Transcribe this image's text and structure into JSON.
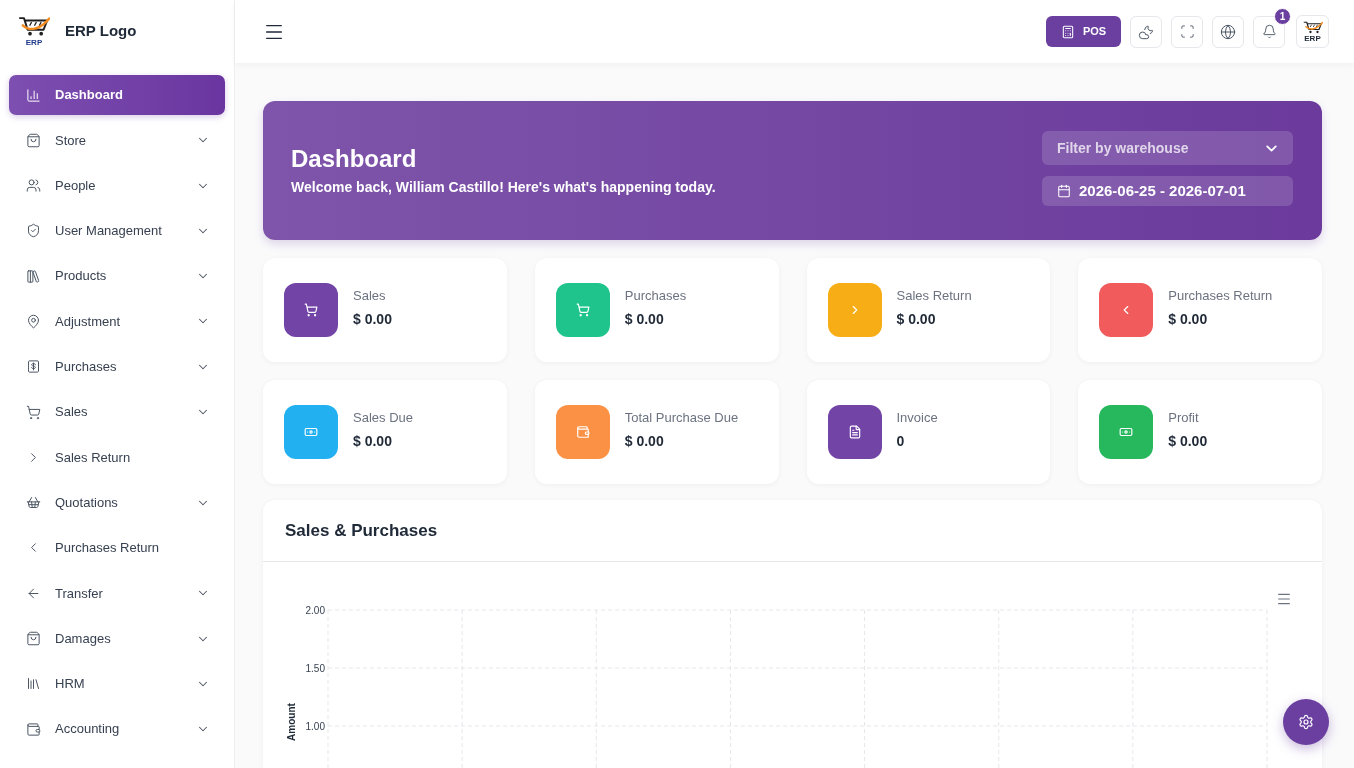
{
  "sidebar": {
    "brand": {
      "mark": "ERP",
      "name": "ERP Logo"
    },
    "items": [
      {
        "label": "Dashboard",
        "selected": true,
        "has_submenu": false
      },
      {
        "label": "Store",
        "selected": false,
        "has_submenu": true
      },
      {
        "label": "People",
        "selected": false,
        "has_submenu": true
      },
      {
        "label": "User Management",
        "selected": false,
        "has_submenu": true
      },
      {
        "label": "Products",
        "selected": false,
        "has_submenu": true
      },
      {
        "label": "Adjustment",
        "selected": false,
        "has_submenu": true
      },
      {
        "label": "Purchases",
        "selected": false,
        "has_submenu": true
      },
      {
        "label": "Sales",
        "selected": false,
        "has_submenu": true
      },
      {
        "label": "Sales Return",
        "selected": false,
        "has_submenu": false
      },
      {
        "label": "Quotations",
        "selected": false,
        "has_submenu": true
      },
      {
        "label": "Purchases Return",
        "selected": false,
        "has_submenu": false
      },
      {
        "label": "Transfer",
        "selected": false,
        "has_submenu": true
      },
      {
        "label": "Damages",
        "selected": false,
        "has_submenu": true
      },
      {
        "label": "HRM",
        "selected": false,
        "has_submenu": true
      },
      {
        "label": "Accounting",
        "selected": false,
        "has_submenu": true
      }
    ]
  },
  "header": {
    "pos_button": "POS",
    "notifications": {
      "count": "1"
    },
    "profile_mark": "ERP"
  },
  "banner": {
    "title": "Dashboard",
    "subtitle": "Welcome back, William Castillo! Here's what's happening today.",
    "warehouse_filter": {
      "placeholder": "Filter by warehouse"
    },
    "date_range": {
      "value": "2026-06-25 - 2026-07-01"
    }
  },
  "stats": [
    {
      "label": "Sales",
      "value": "$ 0.00",
      "color": "#7244a6"
    },
    {
      "label": "Purchases",
      "value": "$ 0.00",
      "color": "#1fc48c"
    },
    {
      "label": "Sales Return",
      "value": "$ 0.00",
      "color": "#f7ad15"
    },
    {
      "label": "Purchases Return",
      "value": "$ 0.00",
      "color": "#f15b5b"
    },
    {
      "label": "Sales Due",
      "value": "$ 0.00",
      "color": "#22b0f0"
    },
    {
      "label": "Total Purchase Due",
      "value": "$ 0.00",
      "color": "#fb9145"
    },
    {
      "label": "Invoice",
      "value": "0",
      "color": "#7244a6"
    },
    {
      "label": "Profit",
      "value": "$ 0.00",
      "color": "#27b85d"
    }
  ],
  "sales_purchases": {
    "title": "Sales & Purchases",
    "y_axis_title": "Amount",
    "y_axis_labels": [
      "2.00",
      "1.50",
      "1.00"
    ]
  }
}
